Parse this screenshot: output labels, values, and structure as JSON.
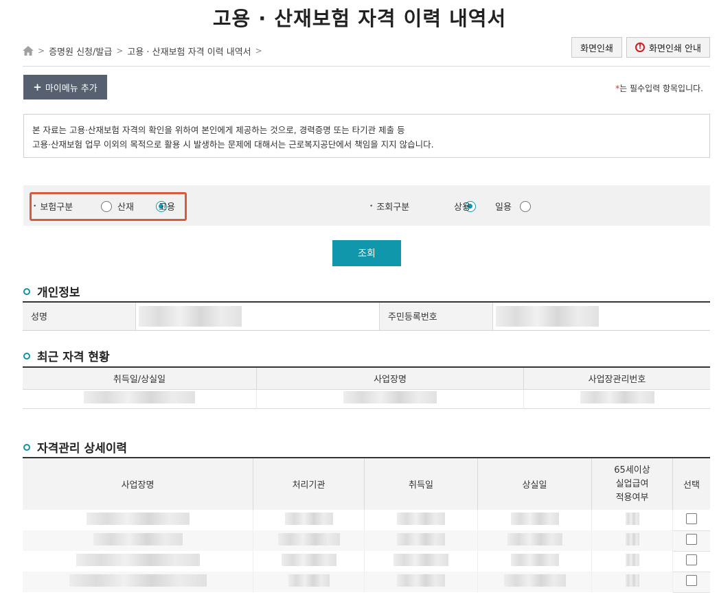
{
  "page_title": "고용 · 산재보험 자격 이력 내역서",
  "breadcrumb": {
    "items": [
      "증명원 신청/발급",
      "고용 · 산재보험 자격 이력 내역서"
    ]
  },
  "toolbar": {
    "print_label": "화면인쇄",
    "print_guide_label": "화면인쇄 안내"
  },
  "mymenu": {
    "plus": "+",
    "label": "마이메뉴 추가"
  },
  "required_note": {
    "star": "*",
    "text": "는 필수입력 항목입니다."
  },
  "notice": {
    "line1": "본 자료는 고용·산재보험 자격의 확인을 위하여 본인에게 제공하는 것으로, 경력증명 또는 타기관 제출 등",
    "line2": "고용·산재보험 업무 이외의 목적으로 활용 시 발생하는 문제에 대해서는 근로복지공단에서 책임을 지지 않습니다."
  },
  "search": {
    "insurance_type": {
      "label": "보험구분",
      "options": [
        "산재",
        "고용"
      ],
      "selected": "고용"
    },
    "query_type": {
      "label": "조회구분",
      "options": [
        "상용",
        "일용"
      ],
      "selected": "상용"
    },
    "submit_label": "조회"
  },
  "personal_info": {
    "title": "개인정보",
    "name_label": "성명",
    "rrn_label": "주민등록번호"
  },
  "recent_status": {
    "title": "최근 자격 현황",
    "columns": [
      "취득일/상실일",
      "사업장명",
      "사업장관리번호"
    ]
  },
  "history": {
    "title": "자격관리 상세이력",
    "columns": [
      "사업장명",
      "처리기관",
      "취득일",
      "상실일",
      "65세이상\n실업급여\n적용여부",
      "선택"
    ],
    "col65": [
      "65세이상",
      "실업급여",
      "적용여부"
    ],
    "row_count": 4
  },
  "colors": {
    "accent": "#1097ab",
    "mymenu_bg": "#566070",
    "highlight_border": "#d45b3e",
    "warning": "#d0181f"
  },
  "icons": [
    "home-icon",
    "warning-icon",
    "plus-icon",
    "section-bullet-icon"
  ]
}
